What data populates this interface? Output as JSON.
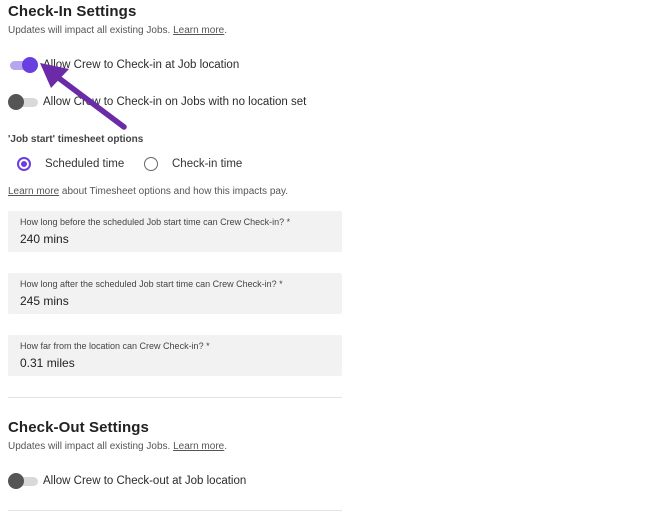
{
  "checkin": {
    "title": "Check-In Settings",
    "subtitle_prefix": "Updates will impact all existing Jobs. ",
    "learn_more": "Learn more",
    "subtitle_suffix": ".",
    "toggles": [
      {
        "label": "Allow Crew to Check-in at Job location",
        "on": true
      },
      {
        "label": "Allow Crew to Check-in on Jobs with no location set",
        "on": false
      }
    ],
    "timesheet_label": "'Job start' timesheet options",
    "radio_options": [
      {
        "label": "Scheduled time",
        "selected": true
      },
      {
        "label": "Check-in time",
        "selected": false
      }
    ],
    "timesheet_learn_more": "Learn more",
    "timesheet_note": " about Timesheet options and how this impacts pay.",
    "fields": [
      {
        "label": "How long before the scheduled Job start time can Crew Check-in? *",
        "value": "240 mins"
      },
      {
        "label": "How long after the scheduled Job start time can Crew Check-in? *",
        "value": "245 mins"
      },
      {
        "label": "How far from the location can Crew Check-in? *",
        "value": "0.31 miles"
      }
    ]
  },
  "checkout": {
    "title": "Check-Out Settings",
    "subtitle_prefix": "Updates will impact all existing Jobs. ",
    "learn_more": "Learn more",
    "subtitle_suffix": ".",
    "toggles": [
      {
        "label": "Allow Crew to Check-out at Job location",
        "on": false
      }
    ]
  },
  "colors": {
    "accent": "#6a3fe2",
    "accent_light": "#b8a6ec",
    "arrow": "#6b2ba8",
    "field_bg": "#f2f2f2"
  },
  "icons": {
    "annotation": "arrow-annotation-icon"
  }
}
